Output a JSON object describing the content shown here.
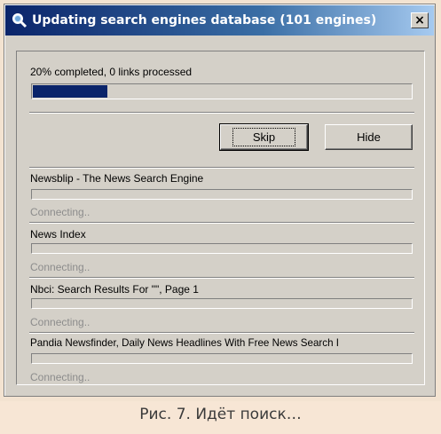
{
  "window": {
    "title": "Updating search engines database (101 engines)",
    "title_icon": "search-icon",
    "close_label": "×"
  },
  "progress": {
    "status_text": "20% completed, 0 links processed",
    "percent": 20
  },
  "buttons": {
    "skip_label": "Skip",
    "hide_label": "Hide"
  },
  "engines": [
    {
      "name": "Newsblip - The News Search Engine",
      "status": "Connecting.."
    },
    {
      "name": "News Index",
      "status": "Connecting.."
    },
    {
      "name": "Nbci: Search Results For \"\", Page 1",
      "status": "Connecting.."
    },
    {
      "name": "Pandia Newsfinder, Daily News Headlines With Free News Search I",
      "status": "Connecting.."
    }
  ],
  "caption": "Рис. 7. Идёт поиск…",
  "colors": {
    "progress_fill": "#0a246a",
    "title_gradient_start": "#0a246a",
    "title_gradient_end": "#a6caf0",
    "window_face": "#d4d0c8"
  }
}
